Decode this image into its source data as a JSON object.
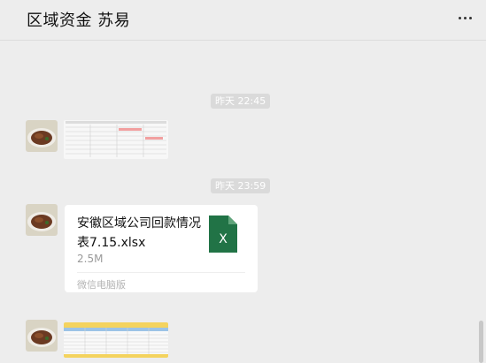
{
  "header": {
    "title": "区域资金 苏易",
    "more_icon": "more-icon"
  },
  "timestamps": [
    "昨天 22:45",
    "昨天 23:59"
  ],
  "messages": {
    "file": {
      "name": "安徽区域公司回款情况表7.15.xlsx",
      "size": "2.5M",
      "source": "微信电脑版",
      "icon": "excel-file-icon"
    }
  },
  "colors": {
    "background": "#ededed",
    "bubble": "#ffffff",
    "excel_green": "#217346"
  }
}
